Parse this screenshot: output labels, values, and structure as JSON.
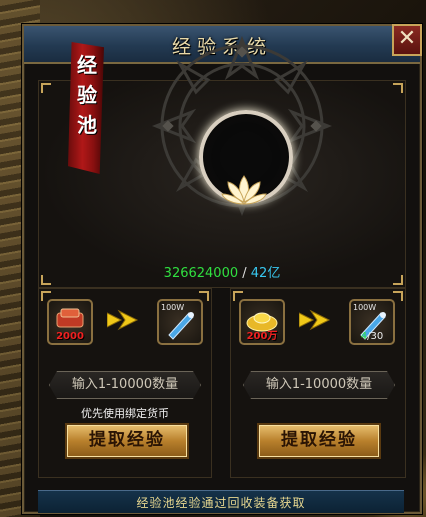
{
  "window": {
    "title": "经验系统",
    "close_label": "✕"
  },
  "pool": {
    "banner_text": "经\n验\n池",
    "current": "326624000",
    "separator": " / ",
    "max": "42亿"
  },
  "left_exchange": {
    "input_item_label": "2000",
    "output_item_label": "100W",
    "input_placeholder": "输入1-10000数量",
    "hint": "优先使用绑定货币",
    "button_label": "提取经验"
  },
  "right_exchange": {
    "input_item_label": "200万",
    "output_item_label": "100W",
    "output_count_current": "4",
    "output_count_max": "/30",
    "input_placeholder": "输入1-10000数量",
    "button_label": "提取经验"
  },
  "footer": {
    "text": "经验池经验通过回收装备获取"
  },
  "colors": {
    "accent_gold": "#c7a45a",
    "value_green": "#30e040",
    "value_cyan": "#38c8f0",
    "banner_red": "#b01818"
  },
  "icons": [
    "close-icon",
    "red-ingot-icon",
    "gold-ingot-icon",
    "exp-scroll-icon",
    "arrow-right-icon",
    "lotus-icon"
  ]
}
